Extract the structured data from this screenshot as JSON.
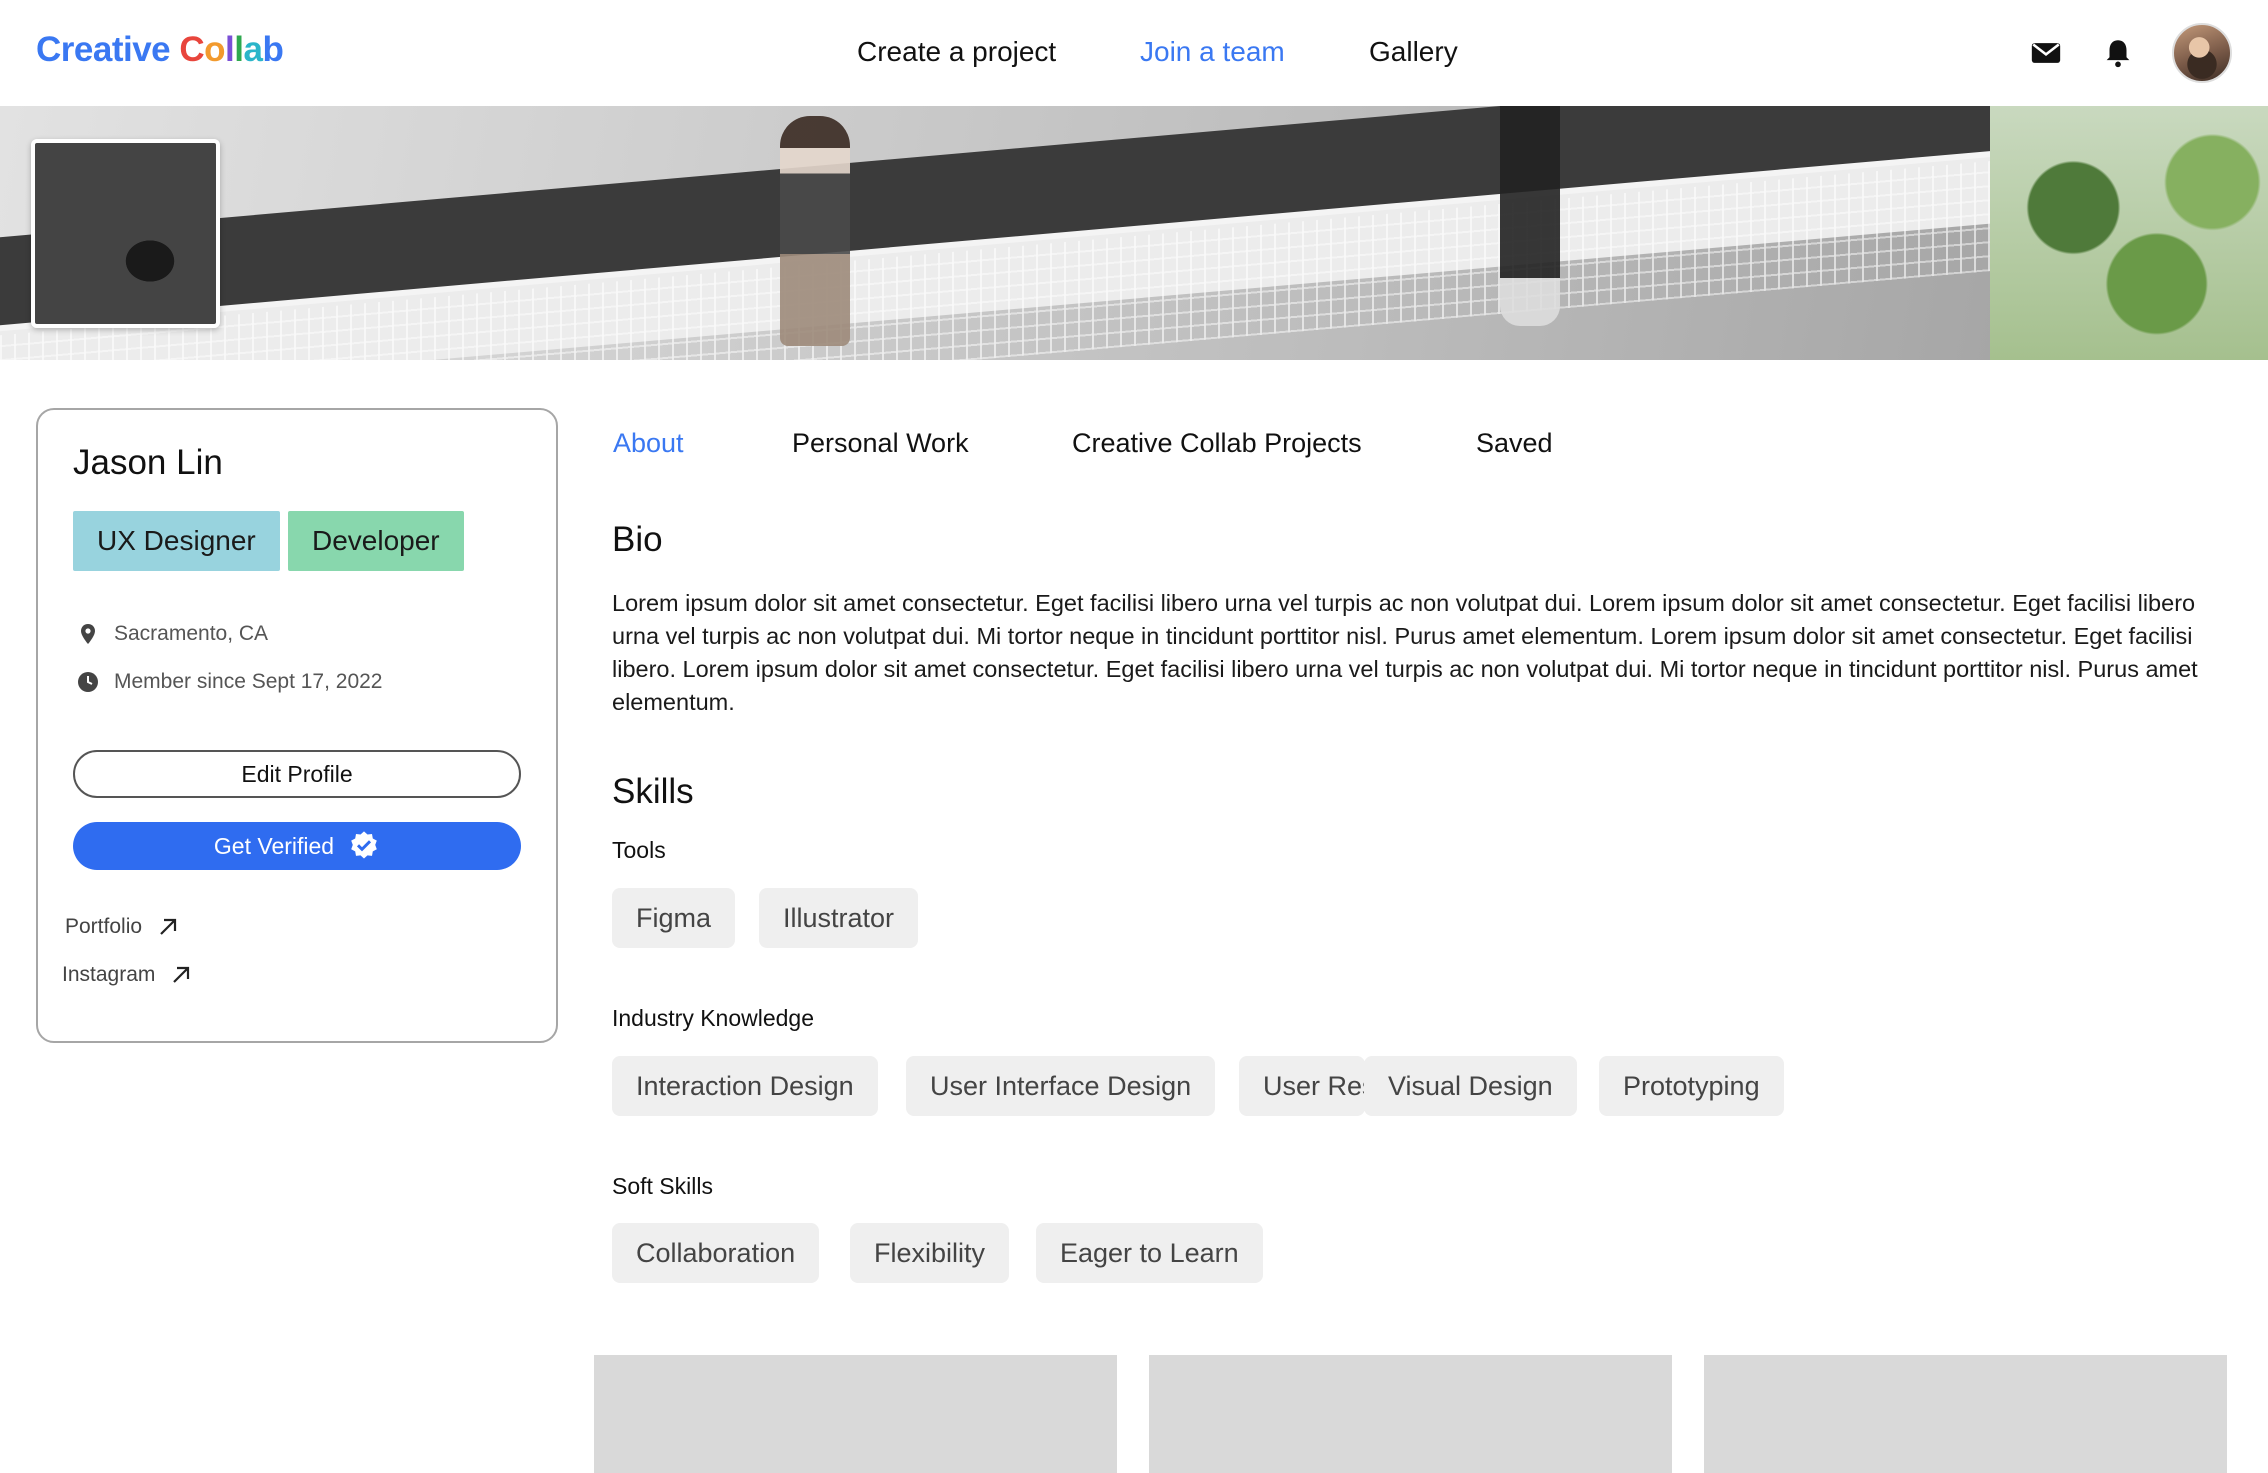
{
  "nav": {
    "logo": "Creative Collab",
    "links": [
      "Create a project",
      "Join a team",
      "Gallery"
    ],
    "active_link": "Join a team",
    "icons": [
      "mail-icon",
      "bell-icon",
      "user-avatar"
    ]
  },
  "profile": {
    "name": "Jason Lin",
    "roles": [
      "UX Designer",
      "Developer"
    ],
    "location": "Sacramento, CA",
    "member_since": "Member since Sept 17, 2022",
    "edit_button": "Edit Profile",
    "verify_button": "Get Verified",
    "links": [
      "Portfolio",
      "Instagram"
    ]
  },
  "tabs": [
    "About",
    "Personal Work",
    "Creative Collab Projects",
    "Saved"
  ],
  "active_tab": "About",
  "about": {
    "bio_heading": "Bio",
    "bio_text": "Lorem ipsum dolor sit amet consectetur. Eget facilisi libero urna vel turpis ac non volutpat dui. Lorem ipsum dolor sit amet consectetur. Eget facilisi libero urna vel turpis ac non volutpat dui. Mi tortor neque in tincidunt porttitor nisl. Purus amet elementum. Lorem ipsum dolor sit amet consectetur. Eget facilisi libero. Lorem ipsum dolor sit amet consectetur. Eget facilisi libero urna vel turpis ac non volutpat dui. Mi tortor neque in tincidunt porttitor nisl. Purus amet elementum.",
    "skills_heading": "Skills",
    "tools_label": "Tools",
    "tools": [
      "Figma",
      "Illustrator"
    ],
    "industry_label": "Industry Knowledge",
    "industry": [
      "Interaction Design",
      "User Interface Design",
      "User Res",
      "Visual Design",
      "Prototyping"
    ],
    "soft_label": "Soft Skills",
    "soft": [
      "Collaboration",
      "Flexibility",
      "Eager to Learn"
    ]
  },
  "colors": {
    "accent": "#3a78f2",
    "verify_button": "#2f6cf0",
    "ux_tag": "#98d3de",
    "dev_tag": "#88d7ad",
    "chip_bg": "#efefef",
    "placeholder": "#d9d9d9"
  }
}
